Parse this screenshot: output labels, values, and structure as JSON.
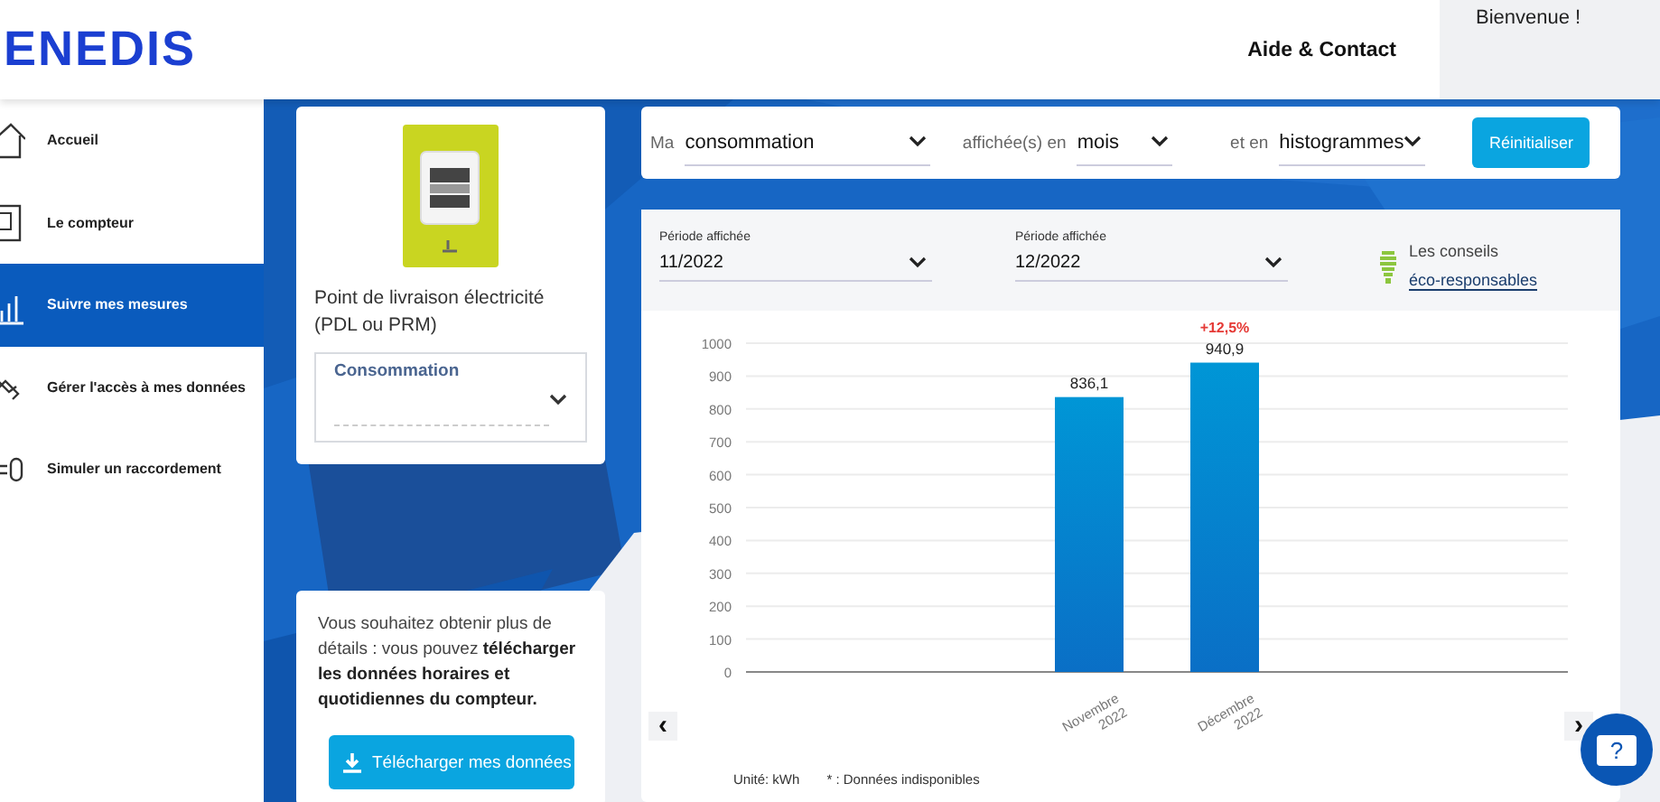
{
  "header": {
    "logo": "ENEDIS",
    "links": [
      "Aide & Contact"
    ],
    "welcome": "Bienvenue !"
  },
  "sidebar": {
    "items": [
      {
        "label": "Accueil",
        "selected": false
      },
      {
        "label": "Le compteur",
        "selected": false
      },
      {
        "label": "Suivre mes mesures",
        "selected": true
      },
      {
        "label": "Gérer l'accès à mes données",
        "selected": false
      },
      {
        "label": "Simuler un raccordement",
        "selected": false
      }
    ]
  },
  "meter_card": {
    "title": "Point de livraison électricité (PDL ou PRM)",
    "select_label": "Consommation"
  },
  "download_card": {
    "text": "Vous souhaitez obtenir plus de détails : vous pouvez **télécharger les données horaires et quotidiennes du compteur.**",
    "button": "Télécharger mes données"
  },
  "filters": {
    "items": [
      {
        "prefix": "Ma",
        "value": "consommation"
      },
      {
        "prefix": "affichée(s) en",
        "value": "mois"
      },
      {
        "prefix": "et en",
        "value": "histogrammes"
      }
    ],
    "button": "Réinitialiser"
  },
  "periods": [
    {
      "label": "Période affichée",
      "value": "11/2022"
    },
    {
      "label": "Période affichée",
      "value": "12/2022"
    }
  ],
  "tips": {
    "text": "Les conseils",
    "link": "éco-responsables"
  },
  "chart_data": {
    "type": "bar",
    "categories": [
      "Novembre 2022",
      "Décembre 2022"
    ],
    "series": [
      {
        "color": "#0a6fc6",
        "values": [
          836.1,
          940.9
        ]
      }
    ],
    "ylim": [
      0,
      1000
    ],
    "yticks": [
      0,
      100,
      200,
      300,
      400,
      500,
      600,
      700,
      800,
      900,
      1000
    ],
    "grid": true,
    "value_labels": [
      "836,1",
      "940,9"
    ],
    "annotations": [
      "+12,5%"
    ]
  },
  "chart_nav": {
    "prev": "‹",
    "next": "›"
  },
  "legend": {
    "unit": "Unité: kWh",
    "note": "* : Données indisponibles"
  },
  "help_button": "?"
}
